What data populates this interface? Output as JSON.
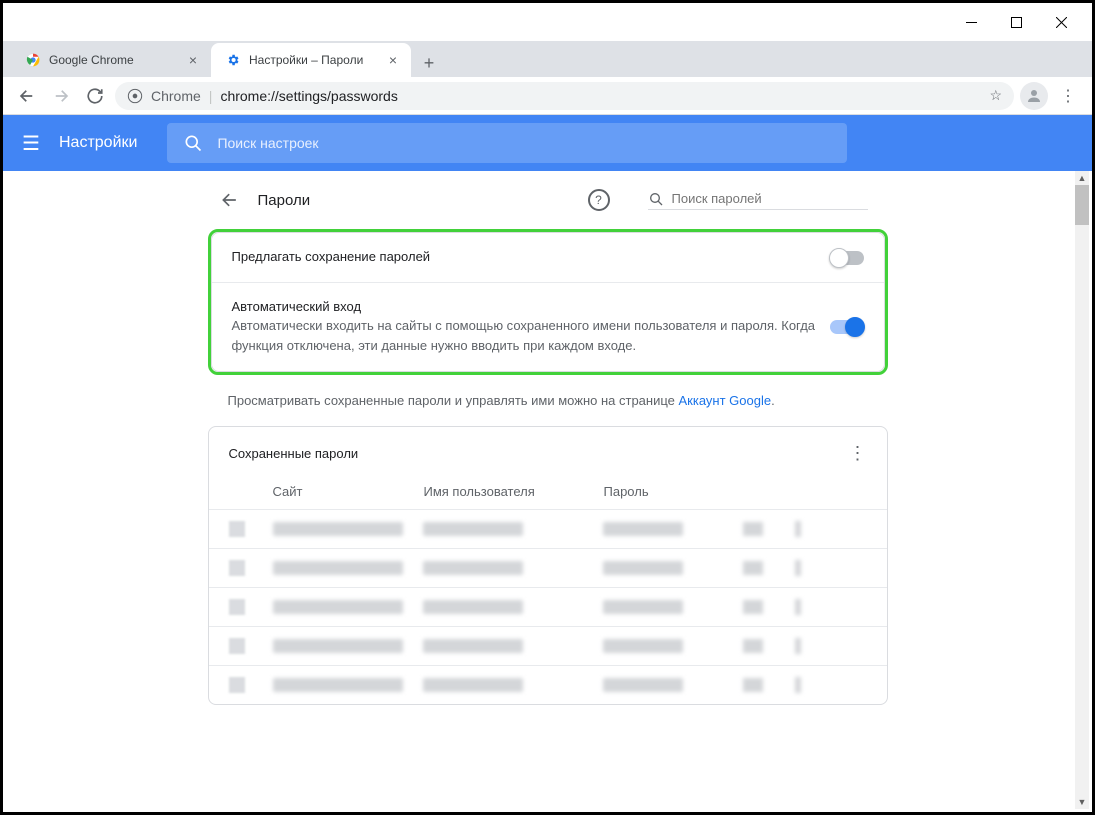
{
  "window": {
    "tabs": [
      {
        "title": "Google Chrome",
        "active": false
      },
      {
        "title": "Настройки – Пароли",
        "active": true
      }
    ]
  },
  "nav": {
    "chrome_label": "Chrome",
    "url": "chrome://settings/passwords"
  },
  "header": {
    "title": "Настройки",
    "search_placeholder": "Поиск настроек"
  },
  "page": {
    "back_title": "Пароли",
    "search_placeholder": "Поиск паролей",
    "offer_save": {
      "title": "Предлагать сохранение паролей",
      "on": false
    },
    "auto_signin": {
      "title": "Автоматический вход",
      "desc": "Автоматически входить на сайты с помощью сохраненного имени пользователя и пароля. Когда функция отключена, эти данные нужно вводить при каждом входе.",
      "on": true
    },
    "info_prefix": "Просматривать сохраненные пароли и управлять ими можно на странице ",
    "info_link": "Аккаунт Google",
    "saved_title": "Сохраненные пароли",
    "cols": {
      "site": "Сайт",
      "user": "Имя пользователя",
      "pass": "Пароль"
    },
    "row_count": 5
  }
}
